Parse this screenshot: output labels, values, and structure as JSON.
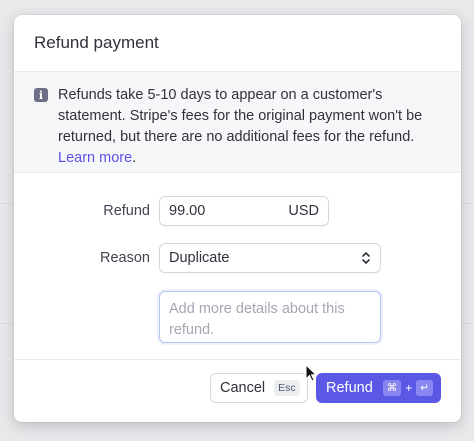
{
  "modal": {
    "title": "Refund payment",
    "notice": {
      "text": "Refunds take 5-10 days to appear on a customer's statement. Stripe's fees for the original payment won't be returned, but there are no additional fees for the refund.",
      "link": "Learn more",
      "suffix": ".",
      "icon": "info-icon"
    },
    "form": {
      "refund_label": "Refund",
      "amount_value": "99.00",
      "currency": "USD",
      "reason_label": "Reason",
      "reason_value": "Duplicate",
      "details_placeholder": "Add more details about this refund."
    },
    "footer": {
      "cancel_label": "Cancel",
      "cancel_shortcut": "Esc",
      "refund_label": "Refund",
      "refund_shortcut_mod": "⌘",
      "refund_shortcut_plus": "+",
      "refund_shortcut_key": "↵"
    }
  },
  "colors": {
    "accent": "#5b58e6",
    "link": "#5a54e6"
  }
}
